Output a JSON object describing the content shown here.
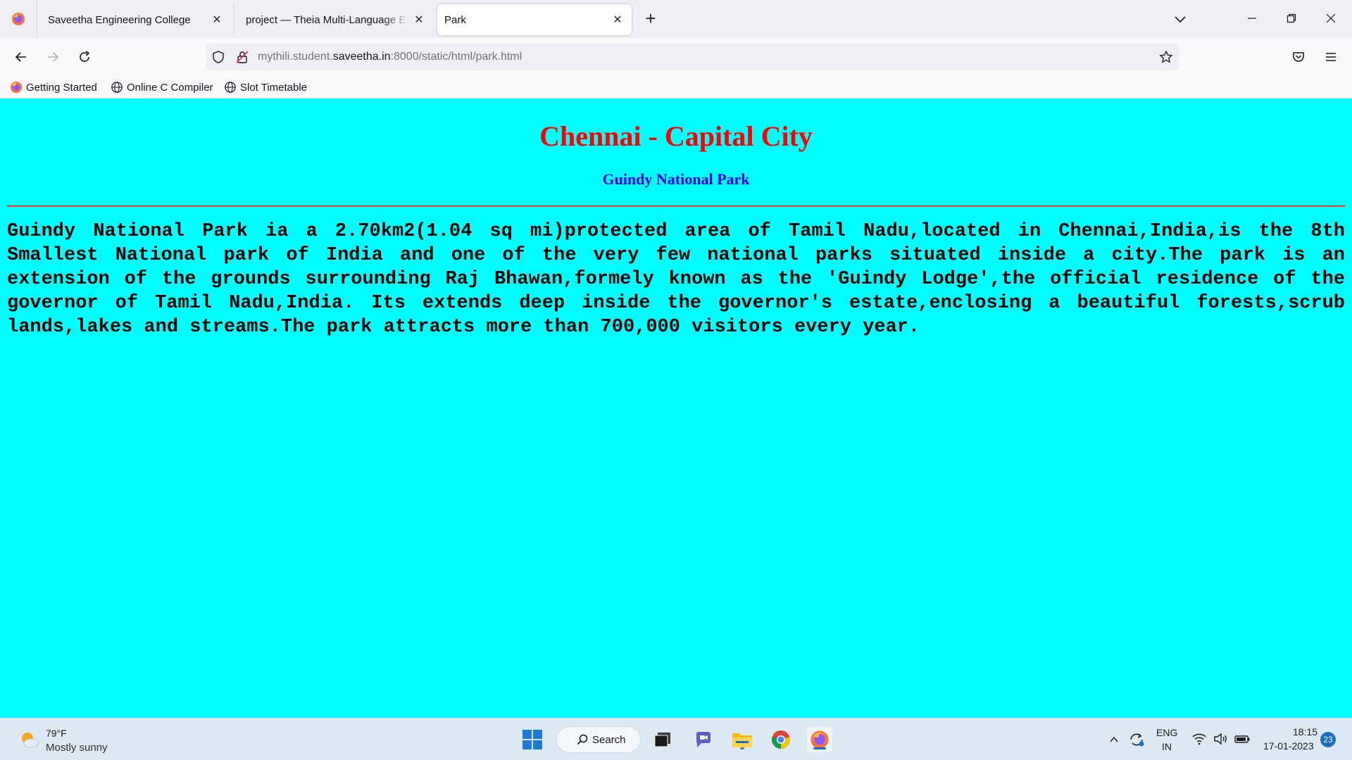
{
  "browser": {
    "tabs": [
      {
        "label": "Saveetha Engineering College",
        "active": false
      },
      {
        "label": "project — Theia Multi-Language Ex",
        "active": false
      },
      {
        "label": "Park",
        "active": true
      }
    ],
    "url": {
      "prefix": "mythili.student.",
      "domain": "saveetha.in",
      "suffix": ":8000/static/html/park.html"
    },
    "bookmarks": [
      {
        "label": "Getting Started",
        "icon": "firefox-icon"
      },
      {
        "label": "Online C Compiler",
        "icon": "globe-icon"
      },
      {
        "label": "Slot Timetable",
        "icon": "globe-icon"
      }
    ]
  },
  "page": {
    "background": "#00ffff",
    "title": "Chennai - Capital City",
    "title_color": "#ff0000",
    "subtitle": "Guindy National Park",
    "subtitle_color": "#0000ff",
    "paragraph": "Guindy National Park ia a 2.70km2(1.04 sq mi)protected area of Tamil Nadu,located in Chennai,India,is the 8th Smallest National park of India and one of the very few national parks situated inside a city.The park is an extension of the grounds surrounding Raj Bhawan,formely known as the 'Guindy Lodge',the official residence of the governor of Tamil Nadu,India. Its extends deep inside the governor's estate,enclosing a beautiful forests,scrub lands,lakes and streams.The park attracts more than 700,000 visitors every year."
  },
  "taskbar": {
    "weather": {
      "temp": "79°F",
      "desc": "Mostly sunny"
    },
    "search_label": "Search",
    "language": {
      "line1": "ENG",
      "line2": "IN"
    },
    "time": "18:15",
    "date": "17-01-2023",
    "notifications": "23"
  }
}
